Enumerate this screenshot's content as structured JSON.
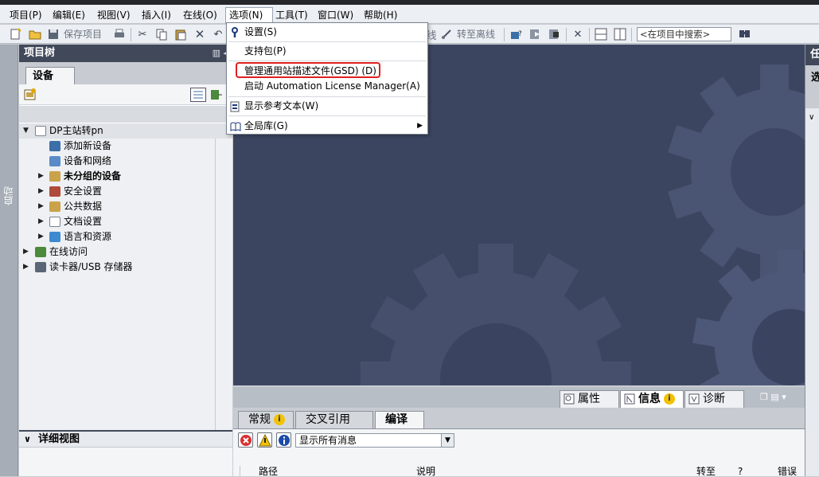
{
  "menubar": {
    "items": [
      "项目(P)",
      "编辑(E)",
      "视图(V)",
      "插入(I)",
      "在线(O)",
      "选项(N)",
      "工具(T)",
      "窗口(W)",
      "帮助(H)"
    ]
  },
  "toolbar": {
    "save_project": "保存项目",
    "go_offline": "转至离线",
    "search_placeholder": "<在项目中搜索>"
  },
  "left_strip": {
    "label": "启动"
  },
  "project_tree": {
    "title": "项目树",
    "devices_tab": "设备",
    "items": [
      {
        "label": "DP主站转pn",
        "bold": false
      },
      {
        "label": "添加新设备",
        "bold": false
      },
      {
        "label": "设备和网络",
        "bold": false
      },
      {
        "label": "未分组的设备",
        "bold": true
      },
      {
        "label": "安全设置",
        "bold": false
      },
      {
        "label": "公共数据",
        "bold": false
      },
      {
        "label": "文档设置",
        "bold": false
      },
      {
        "label": "语言和资源",
        "bold": false
      },
      {
        "label": "在线访问",
        "bold": false
      },
      {
        "label": "读卡器/USB 存储器",
        "bold": false
      }
    ]
  },
  "details_view": {
    "title": "详细视图"
  },
  "options_menu": {
    "items": [
      {
        "label": "设置(S)",
        "icon": "wrench-icon"
      },
      {
        "label": "支持包(P)",
        "icon": ""
      },
      {
        "label": "管理通用站描述文件(GSD) (D)",
        "icon": "",
        "highlighted": true
      },
      {
        "label": "启动 Automation License Manager(A)",
        "icon": ""
      },
      {
        "label": "显示参考文本(W)",
        "icon": "reference-text-icon"
      },
      {
        "label": "全局库(G)",
        "icon": "book-icon",
        "submenu": true
      }
    ]
  },
  "right_panel": {
    "title": "任",
    "subtitle": "选"
  },
  "inspector": {
    "top_tabs": [
      "属性",
      "信息",
      "诊断"
    ],
    "sub_tabs": [
      "常规",
      "交叉引用",
      "编译"
    ],
    "active_sub_tab": "编译",
    "filter": "显示所有消息",
    "columns": [
      "路径",
      "说明",
      "转至",
      "?",
      "错误"
    ]
  },
  "colors": {
    "header_dark": "#40485a",
    "workspace_bg": "#3c4560",
    "highlight_red": "#e02020"
  }
}
